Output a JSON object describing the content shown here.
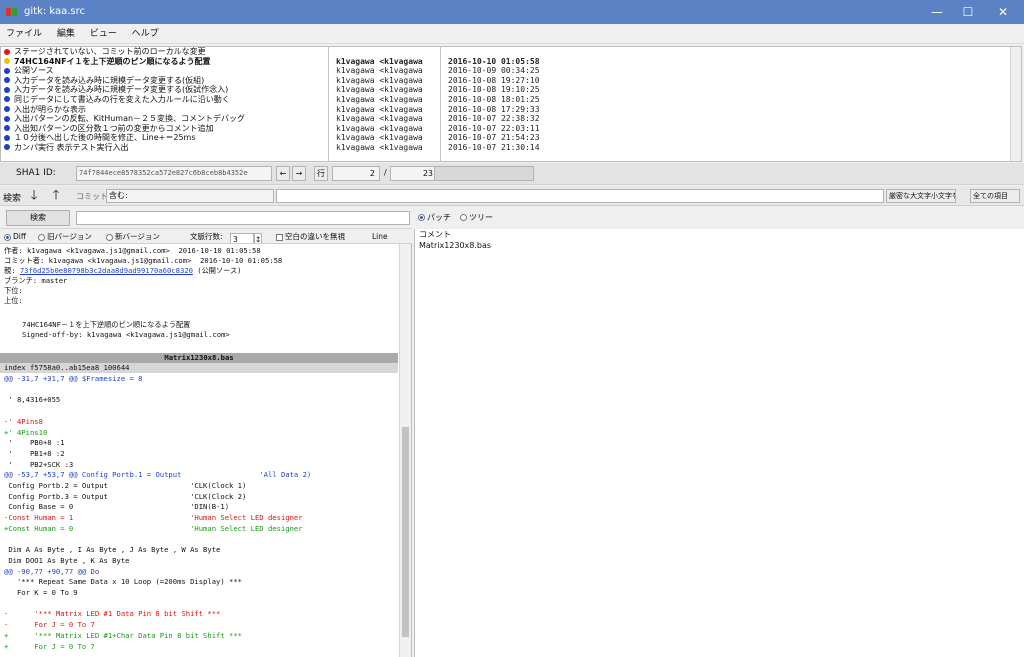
{
  "window": {
    "title": "gitk: kaa.src",
    "min_icon": "minimize-icon",
    "max_icon": "maximize-icon",
    "close_icon": "close-icon"
  },
  "menu": [
    "ファイル",
    "編集",
    "ビュー",
    "ヘルプ"
  ],
  "commits": {
    "subjects": [
      {
        "text": "ステージされていない、コミット前のローカルな変更",
        "color": "#e01515"
      },
      {
        "text": "74HC164NFイ１を上下逆順のピン順になるよう配置",
        "color": "#e6c800"
      },
      {
        "text": "公開ソース",
        "color": "#1d3fc8"
      },
      {
        "text": "入力データを読み込み時に規模データ変更する(仮組)",
        "color": "#1d3fc8"
      },
      {
        "text": "入力データを読み込み時に規模データ変更する(仮試作念入)",
        "color": "#1d3fc8"
      },
      {
        "text": "同じデータにして書込みの行を変えた入力ルールに沿い動く",
        "color": "#1d3fc8"
      },
      {
        "text": "入出が明らかな表示",
        "color": "#1d3fc8"
      },
      {
        "text": "入出パターンの反転、KitHuman－２５変換、コメントデバッグ",
        "color": "#1d3fc8"
      },
      {
        "text": "入出知パターンの区分数１つ前の変更からコメント追加",
        "color": "#1d3fc8"
      },
      {
        "text": "１０分後へ出した後の時間を修正、Line+＝25ms",
        "color": "#1d3fc8"
      },
      {
        "text": "カンパ実行 表示テスト実行入出",
        "color": "#1d3fc8"
      }
    ],
    "authors": [
      "",
      "k1vagawa <k1vagawa",
      "k1vagawa <k1vagawa",
      "k1vagawa <k1vagawa",
      "k1vagawa <k1vagawa",
      "k1vagawa <k1vagawa",
      "k1vagawa <k1vagawa",
      "k1vagawa <k1vagawa",
      "k1vagawa <k1vagawa",
      "k1vagawa <k1vagawa",
      "k1vagawa <k1vagawa"
    ],
    "dates": [
      "",
      "2016-10-10 01:05:58",
      "2016-10-09 00:34:25",
      "2016-10-08 19:27:10",
      "2016-10-08 19:10:25",
      "2016-10-08 18:01:25",
      "2016-10-08 17:29:33",
      "2016-10-07 22:38:32",
      "2016-10-07 22:03:11",
      "2016-10-07 21:54:23",
      "2016-10-07 21:30:14"
    ]
  },
  "sha": {
    "label": "SHA1 ID:",
    "value": "74f7844ece8578352ca572e827c6b8ceb8b4352e",
    "prev": "←",
    "next": "→",
    "row_label": "行",
    "current": "2",
    "total": "23"
  },
  "find": {
    "label": "検索",
    "down_icon": "arrow-down-icon",
    "up_icon": "arrow-up-icon",
    "commit_label": "コミット",
    "mode": "含む:",
    "query": "",
    "case_option": "厳密な大文字小文字を",
    "fields_option": "全ての項目"
  },
  "search": {
    "button": "検索",
    "query": ""
  },
  "diff_options": {
    "diff": "Diff",
    "old": "旧バージョン",
    "new": "新バージョン",
    "context_label": "文脈行数:",
    "context": "3",
    "ignore_ws": "空白の違いを無視",
    "line": "Line"
  },
  "commit_info": {
    "author": "作者: k1vagawa <k1vagawa.js1@gmail.com>  2016-10-10 01:05:58",
    "committer": "コミット者: k1vagawa <k1vagawa.js1@gmail.com>  2016-10-10 01:05:58",
    "parent_label": "親:",
    "parent_sha": "73f6d25b0e80798b3c2daa8d9ad99170a60c8320",
    "parent_note": "(公開ソース)",
    "branch": "ブランチ: master",
    "follows": "下位:",
    "precedes": "上位:",
    "message": "74HC164NF－１を上下逆順のピン順になるよう配置",
    "signoff": "Signed-off-by: k1vagawa <k1vagawa.js1@gmail.com>"
  },
  "diff": {
    "file_header": "Matrix1230x8.bas",
    "index_line": "index f5758a0..ab15ea8 100644",
    "lines": [
      {
        "t": "@@ -31,7 +31,7 @@ $Framesize = 8",
        "c": "c-blue"
      },
      {
        "t": "",
        "c": ""
      },
      {
        "t": " ' 8,4316+055",
        "c": ""
      },
      {
        "t": "",
        "c": ""
      },
      {
        "t": "-' 4Pins8",
        "c": "c-red"
      },
      {
        "t": "+' 4Pins10",
        "c": "c-green"
      },
      {
        "t": " '    PB0+8 :1",
        "c": ""
      },
      {
        "t": " '    PB1+8 :2",
        "c": ""
      },
      {
        "t": " '    PB2+SCK :3",
        "c": ""
      },
      {
        "t": "@@ -53,7 +53,7 @@ Config Portb.1 = Output                  'All Data 2)",
        "c": "c-blue"
      },
      {
        "t": " Config Portb.2 = Output                   'CLK(Clock 1)",
        "c": ""
      },
      {
        "t": " Config Portb.3 = Output                   'CLK(Clock 2)",
        "c": ""
      },
      {
        "t": " Config Base = 0                           'DIN(B-1)",
        "c": ""
      },
      {
        "t": "-Const Human = 1                           'Human Select LED designer",
        "c": "c-red"
      },
      {
        "t": "+Const Human = 0                           'Human Select LED designer",
        "c": "c-green"
      },
      {
        "t": "",
        "c": ""
      },
      {
        "t": " Dim A As Byte , I As Byte , J As Byte , W As Byte",
        "c": ""
      },
      {
        "t": " Dim DOO1 As Byte , K As Byte",
        "c": ""
      },
      {
        "t": "@@ -90,77 +90,77 @@ Do",
        "c": "c-blue"
      },
      {
        "t": "   '*** Repeat Same Data x 10 Loop (=200ms Display) ***",
        "c": ""
      },
      {
        "t": "   For K = 0 To 9",
        "c": ""
      },
      {
        "t": "",
        "c": ""
      },
      {
        "t": "-      '*** Matrix LED #1 Data Pin 8 bit Shift ***",
        "c": "c-red"
      },
      {
        "t": "-      For J = 0 To 7",
        "c": "c-red"
      },
      {
        "t": "+      '*** Matrix LED #1+Char Data Pin 8 bit Shift ***",
        "c": "c-green"
      },
      {
        "t": "+      For J = 0 To 7",
        "c": "c-green"
      }
    ]
  },
  "files": {
    "patch": "パッチ",
    "tree": "ツリー",
    "items": [
      "コメント",
      "Matrix1230x8.bas"
    ]
  },
  "colors": {
    "titlebar": "#5b82c4",
    "added": "#169c16",
    "removed": "#e01515",
    "hunk": "#1f3fd8"
  }
}
